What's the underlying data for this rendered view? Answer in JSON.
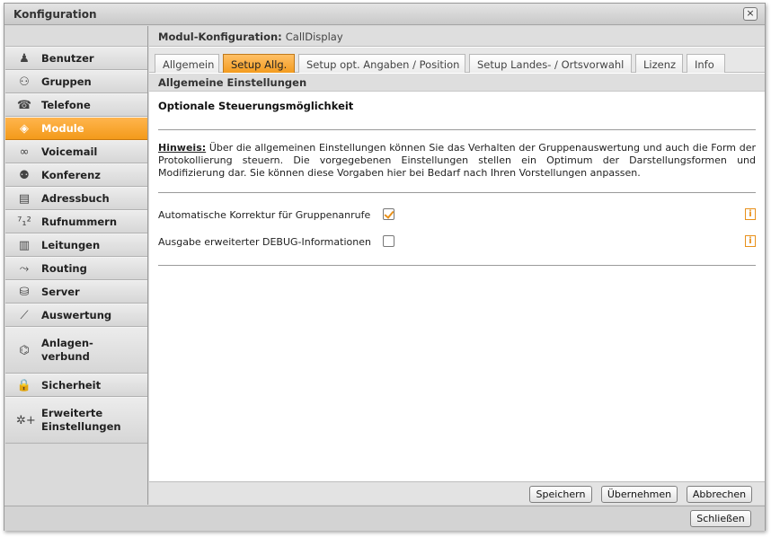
{
  "window": {
    "title": "Konfiguration",
    "close_glyph": "×"
  },
  "sidebar": {
    "items": [
      {
        "label": "Benutzer",
        "icon": "user-icon",
        "glyph": "♟"
      },
      {
        "label": "Gruppen",
        "icon": "group-icon",
        "glyph": "⚇"
      },
      {
        "label": "Telefone",
        "icon": "phone-icon",
        "glyph": "☎"
      },
      {
        "label": "Module",
        "icon": "module-icon",
        "glyph": "◈",
        "active": true
      },
      {
        "label": "Voicemail",
        "icon": "voicemail-icon",
        "glyph": "∞"
      },
      {
        "label": "Konferenz",
        "icon": "conference-icon",
        "glyph": "⚉"
      },
      {
        "label": "Adressbuch",
        "icon": "addressbook-icon",
        "glyph": "▤"
      },
      {
        "label": "Rufnummern",
        "icon": "numbers-icon",
        "glyph": "⁷₁²"
      },
      {
        "label": "Leitungen",
        "icon": "lines-icon",
        "glyph": "▥"
      },
      {
        "label": "Routing",
        "icon": "routing-icon",
        "glyph": "⤳"
      },
      {
        "label": "Server",
        "icon": "server-icon",
        "glyph": "⛁"
      },
      {
        "label": "Auswertung",
        "icon": "chart-icon",
        "glyph": "⟋"
      },
      {
        "label": "Anlagen-\nverbund",
        "icon": "network-icon",
        "glyph": "⌬"
      },
      {
        "label": "Sicherheit",
        "icon": "lock-icon",
        "glyph": "🔒"
      },
      {
        "label": "Erweiterte\nEinstellungen",
        "icon": "advanced-settings-icon",
        "glyph": "✲+"
      }
    ]
  },
  "module": {
    "heading_key": "Modul-Konfiguration:",
    "heading_value": "CallDisplay"
  },
  "tabs": [
    {
      "label": "Allgemein"
    },
    {
      "label": "Setup Allg.",
      "active": true
    },
    {
      "label": "Setup opt. Angaben / Position"
    },
    {
      "label": "Setup Landes- / Ortsvorwahl"
    },
    {
      "label": "Lizenz"
    },
    {
      "label": "Info"
    }
  ],
  "section": {
    "title": "Allgemeine Einstellungen",
    "subtitle": "Optionale Steuerungsmöglichkeit",
    "hint_keyword": "Hinweis:",
    "hint_text": " Über die allgemeinen Einstellungen können Sie das Verhalten der Gruppenauswertung und auch die Form der Protokollierung steuern. Die vorgegebenen Einstellungen stellen ein Optimum der Darstellungsformen und Modifizierung dar. Sie können diese Vorgaben hier bei Bedarf nach Ihren Vorstellungen anpassen."
  },
  "options": [
    {
      "label": "Automatische Korrektur für Gruppenanrufe",
      "checked": true,
      "info": "i"
    },
    {
      "label": "Ausgabe erweiterter DEBUG-Informationen",
      "checked": false,
      "info": "i"
    }
  ],
  "buttons": {
    "save": "Speichern",
    "apply": "Übernehmen",
    "cancel": "Abbrechen",
    "close": "Schließen"
  },
  "colors": {
    "accent": "#f39b1f"
  }
}
